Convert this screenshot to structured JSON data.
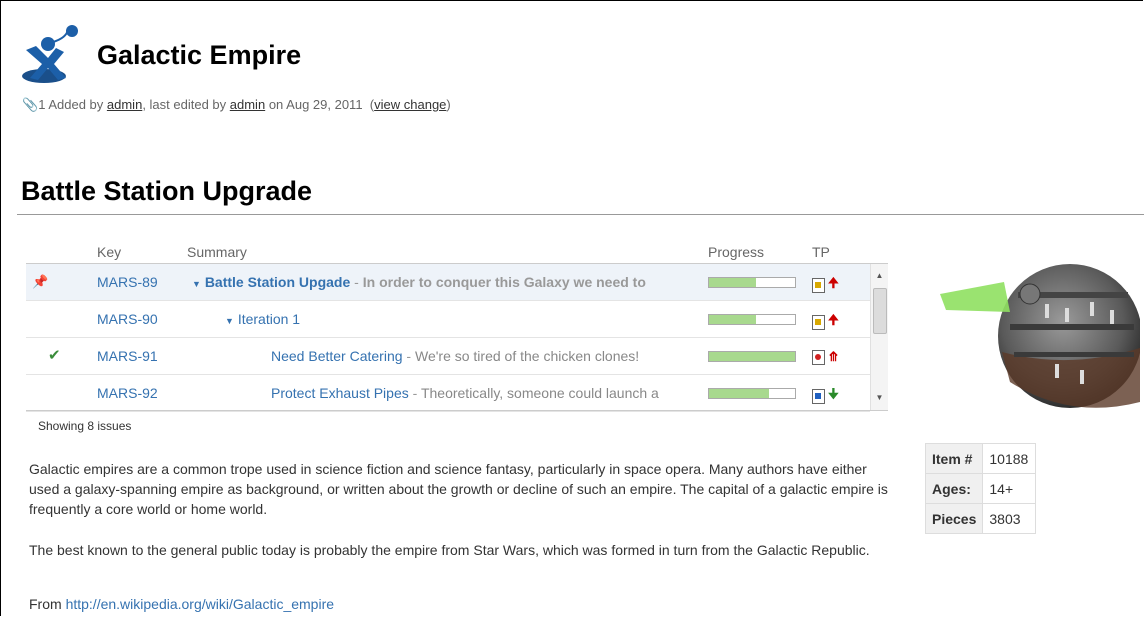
{
  "header": {
    "title": "Galactic Empire",
    "attach_count": "1",
    "added_by_prefix": "Added by",
    "added_by": "admin",
    "edited_prefix": ", last edited by",
    "edited_by": "admin",
    "date_text": "on Aug 29, 2011",
    "view_change_open": "(",
    "view_change": "view change",
    "view_change_close": ")"
  },
  "section": {
    "title": "Battle Station Upgrade"
  },
  "issues": {
    "columns": {
      "key": "Key",
      "summary": "Summary",
      "progress": "Progress",
      "tp": "TP"
    },
    "rows": [
      {
        "key": "MARS-89",
        "title": "Battle Station Upgade",
        "sep": "-",
        "desc": "In order to conquer this Galaxy we need to",
        "progress": 0.55,
        "status": "pin",
        "tp_icon": "gold",
        "priority": "up-red"
      },
      {
        "key": "MARS-90",
        "title": "Iteration 1",
        "sep": "",
        "desc": "",
        "progress": 0.55,
        "status": "",
        "tp_icon": "gold",
        "priority": "up-red"
      },
      {
        "key": "MARS-91",
        "title": "Need Better Catering",
        "sep": "-",
        "desc": "We're so tired of the chicken clones!",
        "progress": 1.0,
        "status": "done",
        "tp_icon": "heart",
        "priority": "up-red-double"
      },
      {
        "key": "MARS-92",
        "title": "Protect Exhaust Pipes",
        "sep": "-",
        "desc": "Theoretically, someone could launch a",
        "progress": 0.7,
        "status": "",
        "tp_icon": "arrow",
        "priority": "down-green"
      }
    ],
    "showing": "Showing 8 issues"
  },
  "body": {
    "para1": "Galactic empires are a common trope used in science fiction and science fantasy, particularly in space opera. Many authors have either used a galaxy-spanning empire as background, or written about the growth or decline of such an empire. The capital of a galactic empire is frequently a core world or home world.",
    "para2": "The best known to the general public today is probably the empire from Star Wars, which was formed in turn from the Galactic Republic.",
    "from_label": "From",
    "link": "http://en.wikipedia.org/wiki/Galactic_empire"
  },
  "info": [
    {
      "label": "Item #",
      "value": "10188"
    },
    {
      "label": "Ages:",
      "value": "14+"
    },
    {
      "label": "Pieces",
      "value": "3803"
    }
  ],
  "colors": {
    "link": "#3572b0",
    "progress": "#a8d98e",
    "highlight": "#eef3f9"
  }
}
